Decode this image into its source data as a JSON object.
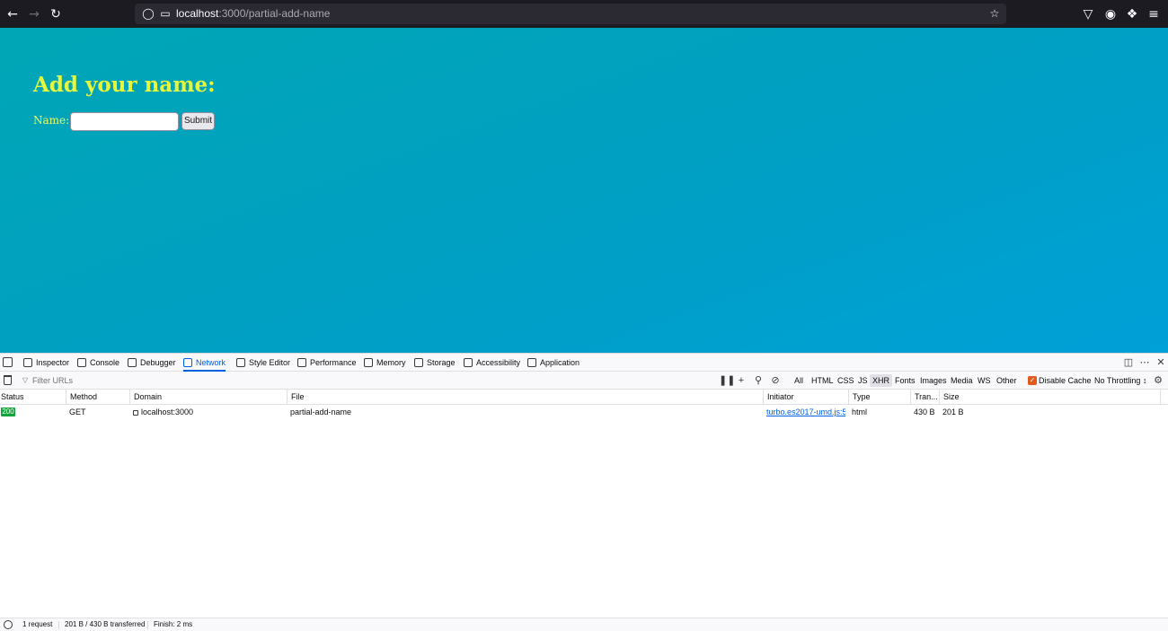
{
  "browser": {
    "back_icon": "arrow-left-icon",
    "forward_icon": "arrow-right-icon",
    "reload_icon": "reload-icon",
    "url_host": "localhost",
    "url_path": ":3000/partial-add-name"
  },
  "page": {
    "title": "Add your name:",
    "name_label": "Name:",
    "name_value": "",
    "submit_label": "Submit",
    "colors": {
      "title": "#e7f73c",
      "background": "#00a3c6"
    }
  },
  "devtools": {
    "tabs": [
      {
        "label": "Inspector",
        "icon": "inspector-icon"
      },
      {
        "label": "Console",
        "icon": "console-icon"
      },
      {
        "label": "Debugger",
        "icon": "debugger-icon"
      },
      {
        "label": "Network",
        "icon": "network-icon",
        "active": true
      },
      {
        "label": "Style Editor",
        "icon": "style-editor-icon"
      },
      {
        "label": "Performance",
        "icon": "performance-icon"
      },
      {
        "label": "Memory",
        "icon": "memory-icon"
      },
      {
        "label": "Storage",
        "icon": "storage-icon"
      },
      {
        "label": "Accessibility",
        "icon": "accessibility-icon"
      },
      {
        "label": "Application",
        "icon": "application-icon"
      }
    ],
    "filter_placeholder": "Filter URLs",
    "type_filters": [
      "All",
      "HTML",
      "CSS",
      "JS",
      "XHR",
      "Fonts",
      "Images",
      "Media",
      "WS",
      "Other"
    ],
    "active_type_filter": "XHR",
    "disable_cache_label": "Disable Cache",
    "disable_cache_checked": true,
    "throttling": "No Throttling ↕",
    "columns": [
      "Status",
      "Method",
      "Domain",
      "File",
      "Initiator",
      "Type",
      "Tran...",
      "Size"
    ],
    "requests": [
      {
        "status": "200",
        "method": "GET",
        "domain": "localhost:3000",
        "file": "partial-add-name",
        "initiator": "turbo.es2017-umd.js:52...",
        "type": "html",
        "transferred": "430 B",
        "size": "201 B"
      }
    ],
    "summary": {
      "requests": "1 request",
      "transferred": "201 B / 430 B transferred",
      "finish": "Finish: 2 ms"
    }
  }
}
